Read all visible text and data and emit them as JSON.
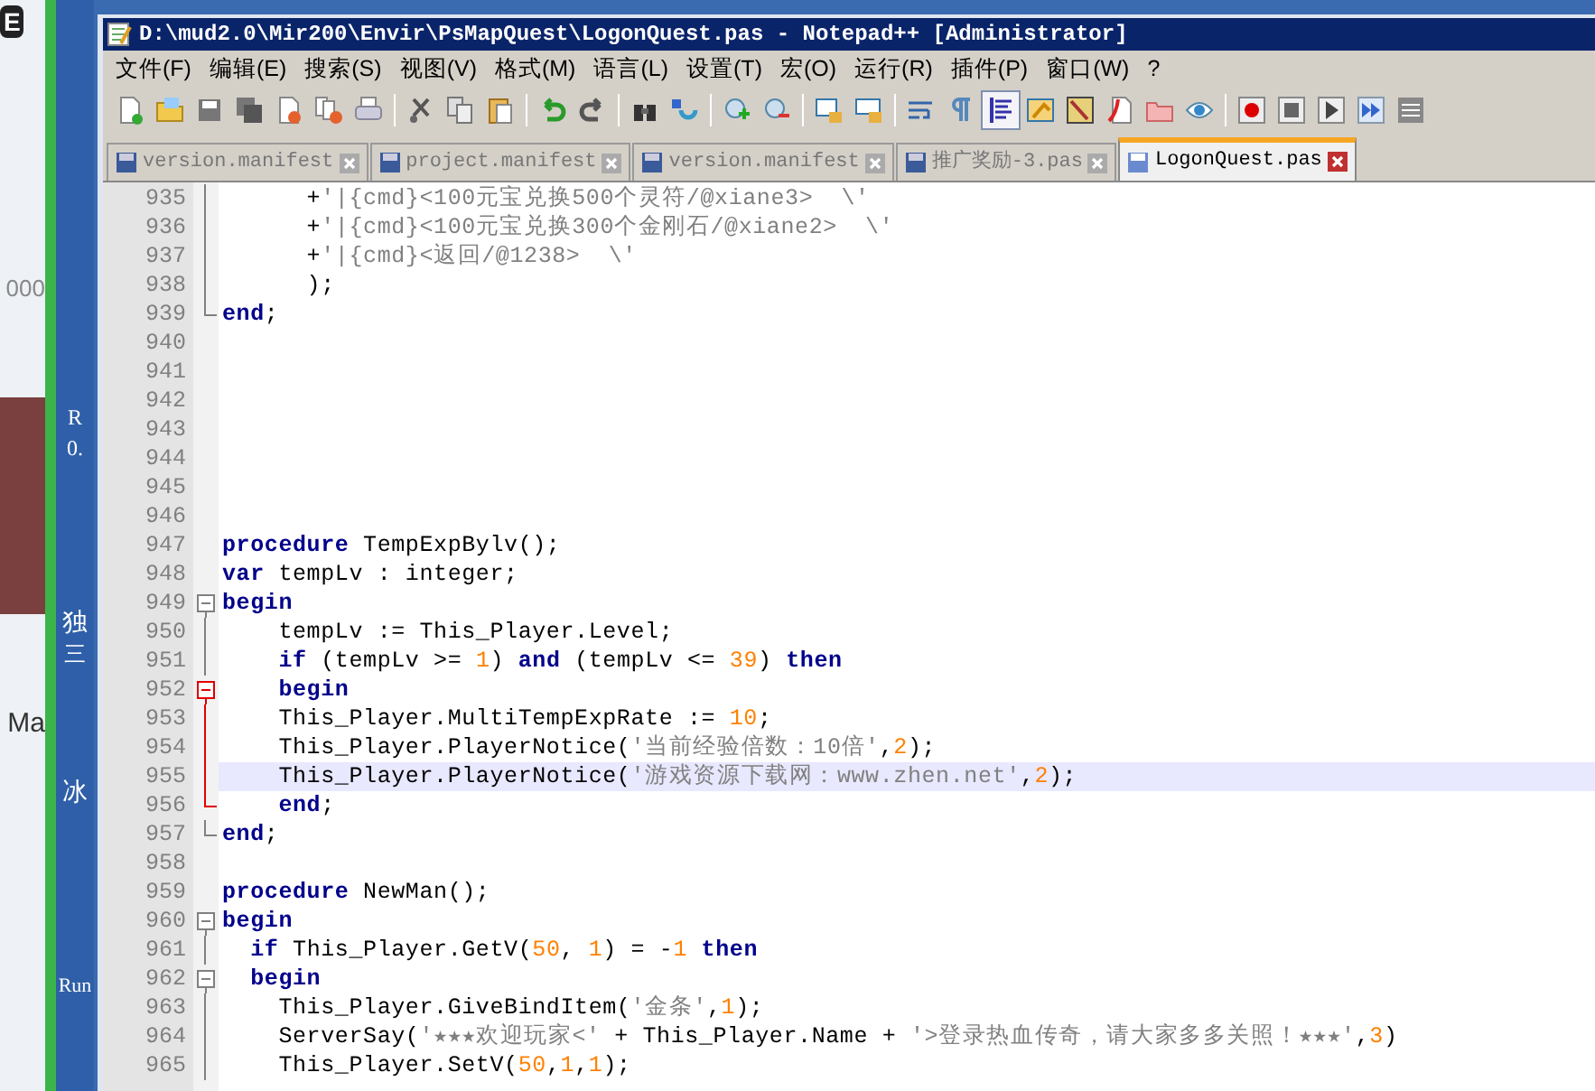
{
  "desktop": {
    "left_fragments": [
      "000",
      "Ma"
    ],
    "strip_fragments": [
      "R",
      "0.",
      "独",
      "三",
      "冰",
      "Run"
    ],
    "badge": "E"
  },
  "window": {
    "title": "D:\\mud2.0\\Mir200\\Envir\\PsMapQuest\\LogonQuest.pas - Notepad++ [Administrator]"
  },
  "menu": [
    "文件(F)",
    "编辑(E)",
    "搜索(S)",
    "视图(V)",
    "格式(M)",
    "语言(L)",
    "设置(T)",
    "宏(O)",
    "运行(R)",
    "插件(P)",
    "窗口(W)",
    "?"
  ],
  "toolbar": [
    [
      {
        "pressed": false
      },
      {
        "pressed": false
      },
      {
        "pressed": false
      },
      {
        "pressed": false
      },
      {
        "pressed": false
      },
      {
        "pressed": false
      },
      {
        "pressed": false
      }
    ],
    [
      {
        "pressed": false
      },
      {
        "pressed": false
      },
      {
        "pressed": false
      }
    ],
    [
      {
        "pressed": false
      },
      {
        "pressed": false
      }
    ],
    [
      {
        "pressed": false
      },
      {
        "pressed": false
      }
    ],
    [
      {
        "pressed": false
      },
      {
        "pressed": false
      }
    ],
    [
      {
        "pressed": false
      },
      {
        "pressed": false
      }
    ],
    [
      {
        "pressed": false
      },
      {
        "pressed": false
      },
      {
        "pressed": true
      },
      {
        "pressed": false
      },
      {
        "pressed": false
      },
      {
        "pressed": false
      },
      {
        "pressed": false
      },
      {
        "pressed": false
      }
    ],
    [
      {
        "pressed": false
      },
      {
        "pressed": false
      },
      {
        "pressed": false
      },
      {
        "pressed": false
      },
      {
        "pressed": false
      }
    ]
  ],
  "tabs": [
    {
      "label": "version.manifest",
      "selected": false
    },
    {
      "label": "project.manifest",
      "selected": false
    },
    {
      "label": "version.manifest",
      "selected": false
    },
    {
      "label": "推广奖励-3.pas",
      "selected": false
    },
    {
      "label": "LogonQuest.pas",
      "selected": true
    }
  ],
  "lines": [
    {
      "no": "935",
      "fold": {
        "kind": "line",
        "active": false
      },
      "tokens": [
        {
          "kind": "plain",
          "t": "      +"
        },
        {
          "kind": "string",
          "t": "'|{cmd}<100元宝兑换500个灵符/@xiane3>  \\'"
        }
      ]
    },
    {
      "no": "936",
      "fold": {
        "kind": "line",
        "active": false
      },
      "tokens": [
        {
          "kind": "plain",
          "t": "      +"
        },
        {
          "kind": "string",
          "t": "'|{cmd}<100元宝兑换300个金刚石/@xiane2>  \\'"
        }
      ]
    },
    {
      "no": "937",
      "fold": {
        "kind": "line",
        "active": false
      },
      "tokens": [
        {
          "kind": "plain",
          "t": "      +"
        },
        {
          "kind": "string",
          "t": "'|{cmd}<返回/@1238>  \\'"
        }
      ]
    },
    {
      "no": "938",
      "fold": {
        "kind": "line",
        "active": false
      },
      "tokens": [
        {
          "kind": "plain",
          "t": "      );"
        }
      ]
    },
    {
      "no": "939",
      "fold": {
        "kind": "end",
        "active": false
      },
      "tokens": [
        {
          "kind": "keyword",
          "t": "end"
        },
        {
          "kind": "plain",
          "t": ";"
        }
      ]
    },
    {
      "no": "940"
    },
    {
      "no": "941"
    },
    {
      "no": "942"
    },
    {
      "no": "943"
    },
    {
      "no": "944"
    },
    {
      "no": "945"
    },
    {
      "no": "946"
    },
    {
      "no": "947",
      "tokens": [
        {
          "kind": "keyword",
          "t": "procedure"
        },
        {
          "kind": "plain",
          "t": " TempExpBylv();"
        }
      ]
    },
    {
      "no": "948",
      "tokens": [
        {
          "kind": "keyword",
          "t": "var"
        },
        {
          "kind": "plain",
          "t": " tempLv : integer;"
        }
      ]
    },
    {
      "no": "949",
      "fold": {
        "kind": "box",
        "active": false
      },
      "tokens": [
        {
          "kind": "keyword",
          "t": "begin"
        }
      ]
    },
    {
      "no": "950",
      "fold": {
        "kind": "line",
        "active": false
      },
      "tokens": [
        {
          "kind": "plain",
          "t": "    tempLv := This_Player.Level;"
        }
      ]
    },
    {
      "no": "951",
      "fold": {
        "kind": "line",
        "active": false
      },
      "tokens": [
        {
          "kind": "keyword",
          "t": "    if"
        },
        {
          "kind": "plain",
          "t": " (tempLv >= "
        },
        {
          "kind": "number",
          "t": "1"
        },
        {
          "kind": "plain",
          "t": ") "
        },
        {
          "kind": "keyword",
          "t": "and"
        },
        {
          "kind": "plain",
          "t": " (tempLv <= "
        },
        {
          "kind": "number",
          "t": "39"
        },
        {
          "kind": "plain",
          "t": ") "
        },
        {
          "kind": "keyword",
          "t": "then"
        }
      ]
    },
    {
      "no": "952",
      "fold": {
        "kind": "box",
        "active": true
      },
      "tokens": [
        {
          "kind": "keyword",
          "t": "    begin"
        }
      ]
    },
    {
      "no": "953",
      "fold": {
        "kind": "line",
        "active": true
      },
      "tokens": [
        {
          "kind": "plain",
          "t": "    This_Player.MultiTempExpRate := "
        },
        {
          "kind": "number",
          "t": "10"
        },
        {
          "kind": "plain",
          "t": ";"
        }
      ]
    },
    {
      "no": "954",
      "fold": {
        "kind": "line",
        "active": true
      },
      "tokens": [
        {
          "kind": "plain",
          "t": "    This_Player.PlayerNotice("
        },
        {
          "kind": "string",
          "t": "'当前经验倍数：10倍'"
        },
        {
          "kind": "plain",
          "t": ","
        },
        {
          "kind": "number",
          "t": "2"
        },
        {
          "kind": "plain",
          "t": ");"
        }
      ]
    },
    {
      "no": "955",
      "fold": {
        "kind": "line",
        "active": true
      },
      "current": true,
      "tokens": [
        {
          "kind": "plain",
          "t": "    This_Player.PlayerNotice("
        },
        {
          "kind": "string",
          "t": "'游戏资源下载网：www.zhen.net'"
        },
        {
          "kind": "plain",
          "t": ","
        },
        {
          "kind": "number",
          "t": "2"
        },
        {
          "kind": "plain",
          "t": ");"
        }
      ]
    },
    {
      "no": "956",
      "fold": {
        "kind": "end",
        "active": true
      },
      "tokens": [
        {
          "kind": "keyword",
          "t": "    end"
        },
        {
          "kind": "plain",
          "t": ";"
        }
      ]
    },
    {
      "no": "957",
      "fold": {
        "kind": "end",
        "active": false
      },
      "tokens": [
        {
          "kind": "keyword",
          "t": "end"
        },
        {
          "kind": "plain",
          "t": ";"
        }
      ]
    },
    {
      "no": "958"
    },
    {
      "no": "959",
      "tokens": [
        {
          "kind": "keyword",
          "t": "procedure"
        },
        {
          "kind": "plain",
          "t": " NewMan();"
        }
      ]
    },
    {
      "no": "960",
      "fold": {
        "kind": "box",
        "active": false
      },
      "tokens": [
        {
          "kind": "keyword",
          "t": "begin"
        }
      ]
    },
    {
      "no": "961",
      "fold": {
        "kind": "line",
        "active": false
      },
      "tokens": [
        {
          "kind": "keyword",
          "t": "  if"
        },
        {
          "kind": "plain",
          "t": " This_Player.GetV("
        },
        {
          "kind": "number",
          "t": "50"
        },
        {
          "kind": "plain",
          "t": ", "
        },
        {
          "kind": "number",
          "t": "1"
        },
        {
          "kind": "plain",
          "t": ") = -"
        },
        {
          "kind": "number",
          "t": "1"
        },
        {
          "kind": "keyword",
          "t": " then"
        }
      ]
    },
    {
      "no": "962",
      "fold": {
        "kind": "box",
        "active": false
      },
      "tokens": [
        {
          "kind": "keyword",
          "t": "  begin"
        }
      ]
    },
    {
      "no": "963",
      "fold": {
        "kind": "line",
        "active": false
      },
      "tokens": [
        {
          "kind": "plain",
          "t": "    This_Player.GiveBindItem("
        },
        {
          "kind": "string",
          "t": "'金条'"
        },
        {
          "kind": "plain",
          "t": ","
        },
        {
          "kind": "number",
          "t": "1"
        },
        {
          "kind": "plain",
          "t": ");"
        }
      ]
    },
    {
      "no": "964",
      "fold": {
        "kind": "line",
        "active": false
      },
      "tokens": [
        {
          "kind": "plain",
          "t": "    ServerSay("
        },
        {
          "kind": "string",
          "t": "'★★★欢迎玩家<'"
        },
        {
          "kind": "plain",
          "t": " + This_Player.Name + "
        },
        {
          "kind": "string",
          "t": "'>登录热血传奇，请大家多多关照！★★★'"
        },
        {
          "kind": "plain",
          "t": ","
        },
        {
          "kind": "number",
          "t": "3"
        },
        {
          "kind": "plain",
          "t": ")"
        }
      ]
    },
    {
      "no": "965",
      "fold": {
        "kind": "line",
        "active": false
      },
      "tokens": [
        {
          "kind": "plain",
          "t": "    This_Player.SetV("
        },
        {
          "kind": "number",
          "t": "50"
        },
        {
          "kind": "plain",
          "t": ","
        },
        {
          "kind": "number",
          "t": "1"
        },
        {
          "kind": "plain",
          "t": ","
        },
        {
          "kind": "number",
          "t": "1"
        },
        {
          "kind": "plain",
          "t": ");"
        }
      ]
    }
  ]
}
